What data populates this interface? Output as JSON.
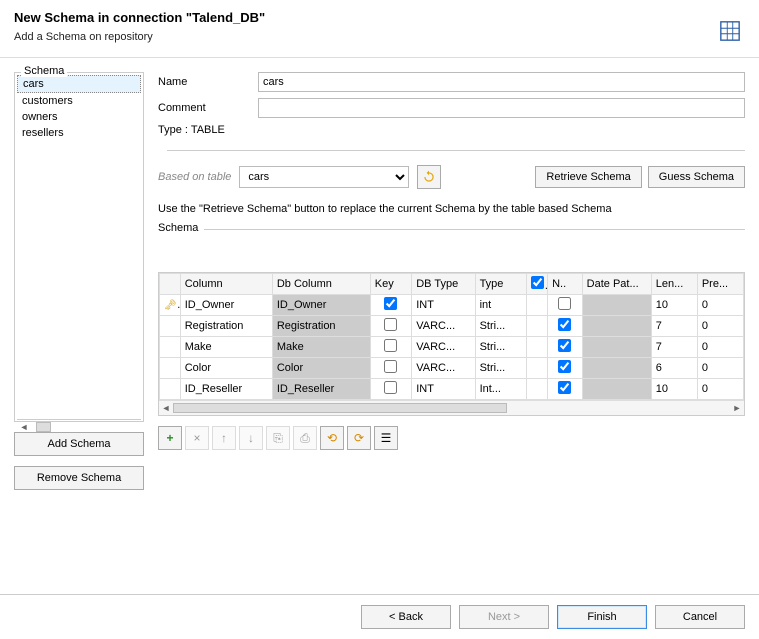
{
  "header": {
    "title": "New Schema in connection \"Talend_DB\"",
    "subtitle": "Add a Schema on repository"
  },
  "sidebar": {
    "legend": "Schema",
    "items": [
      "cars",
      "customers",
      "owners",
      "resellers"
    ],
    "selected": 0,
    "add_label": "Add Schema",
    "remove_label": "Remove Schema"
  },
  "form": {
    "name_label": "Name",
    "name_value": "cars",
    "comment_label": "Comment",
    "comment_value": "",
    "type_label": "Type : TABLE"
  },
  "based": {
    "label": "Based on table",
    "value": "cars",
    "retrieve_label": "Retrieve Schema",
    "guess_label": "Guess Schema"
  },
  "hint": "Use the \"Retrieve Schema\" button to replace the current Schema by the table based Schema",
  "grid": {
    "legend": "Schema",
    "headers": {
      "col": "Column",
      "dbcol": "Db Column",
      "key": "Key",
      "dbtype": "DB Type",
      "type": "Type",
      "null": "N..",
      "datepat": "Date Pat...",
      "len": "Len...",
      "pre": "Pre..."
    },
    "rows": [
      {
        "col": "ID_Owner",
        "dbcol": "ID_Owner",
        "key": true,
        "dbtype": "INT",
        "type": "int",
        "null": false,
        "len": "10",
        "pre": "0",
        "pk": true
      },
      {
        "col": "Registration",
        "dbcol": "Registration",
        "key": false,
        "dbtype": "VARC...",
        "type": "Stri...",
        "null": true,
        "len": "7",
        "pre": "0",
        "pk": false
      },
      {
        "col": "Make",
        "dbcol": "Make",
        "key": false,
        "dbtype": "VARC...",
        "type": "Stri...",
        "null": true,
        "len": "7",
        "pre": "0",
        "pk": false
      },
      {
        "col": "Color",
        "dbcol": "Color",
        "key": false,
        "dbtype": "VARC...",
        "type": "Stri...",
        "null": true,
        "len": "6",
        "pre": "0",
        "pk": false
      },
      {
        "col": "ID_Reseller",
        "dbcol": "ID_Reseller",
        "key": false,
        "dbtype": "INT",
        "type": "Int...",
        "null": true,
        "len": "10",
        "pre": "0",
        "pk": false
      }
    ]
  },
  "toolbar": {
    "add": "+",
    "remove": "×",
    "up": "↑",
    "down": "↓",
    "copy": "⎘",
    "paste": "⎙",
    "import": "⟲",
    "export": "⟳",
    "chk": "☰"
  },
  "footer": {
    "back": "< Back",
    "next": "Next >",
    "finish": "Finish",
    "cancel": "Cancel"
  }
}
